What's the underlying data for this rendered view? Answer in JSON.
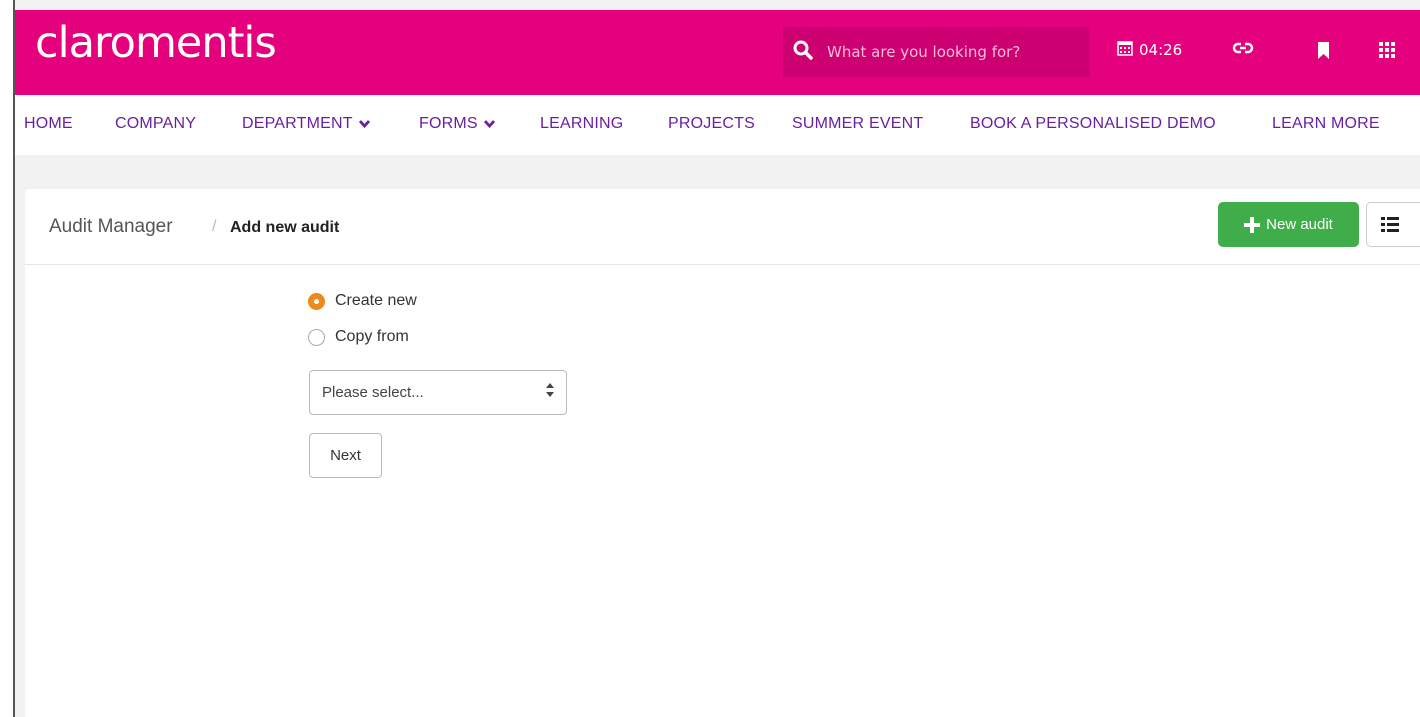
{
  "header": {
    "logo": "claromentis",
    "search_placeholder": "What are you looking for?",
    "clock_time": "04:26"
  },
  "nav": {
    "items": [
      "HOME",
      "COMPANY",
      "DEPARTMENT",
      "FORMS",
      "LEARNING",
      "PROJECTS",
      "SUMMER EVENT",
      "BOOK A PERSONALISED DEMO",
      "LEARN MORE"
    ]
  },
  "breadcrumb": {
    "root": "Audit Manager",
    "separator": "/",
    "current": "Add new audit"
  },
  "actions": {
    "new_audit": "New audit"
  },
  "form": {
    "option_create": "Create new",
    "option_copy": "Copy from",
    "select_value": "Please select...",
    "next": "Next"
  },
  "colors": {
    "brand": "#e5007e",
    "nav_text": "#6a1fa0",
    "success": "#3fae4a",
    "radio_checked": "#f0891d"
  }
}
